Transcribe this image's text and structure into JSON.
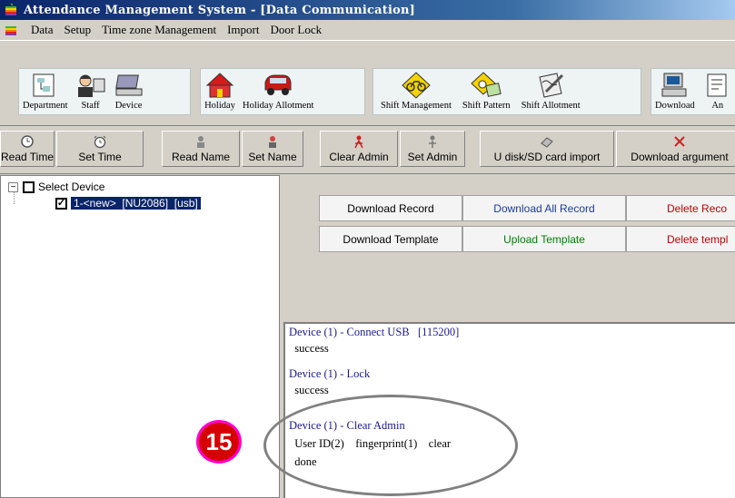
{
  "window": {
    "title": "Attendance Management System - [Data Communication]"
  },
  "menubar": {
    "items": [
      "Data",
      "Setup",
      "Time zone Management",
      "Import",
      "Door Lock"
    ]
  },
  "toolbar": {
    "items": [
      {
        "label": "Department",
        "icon": "department-icon"
      },
      {
        "label": "Staff",
        "icon": "staff-icon"
      },
      {
        "label": "Device",
        "icon": "device-icon"
      },
      {
        "label": "Holiday",
        "icon": "holiday-icon"
      },
      {
        "label": "Holiday Allotment",
        "icon": "car-icon"
      },
      {
        "label": "Shift Management",
        "icon": "bicycle-sign-icon"
      },
      {
        "label": "Shift Pattern",
        "icon": "clock-sign-icon"
      },
      {
        "label": "Shift Allotment",
        "icon": "pen-document-icon"
      },
      {
        "label": "Download",
        "icon": "computer-icon"
      },
      {
        "label": "An",
        "icon": "report-icon"
      }
    ]
  },
  "device_toolbar": {
    "items": [
      {
        "label": "Read Time",
        "icon": "clock-icon"
      },
      {
        "label": "Set Time",
        "icon": "alarm-clock-icon"
      },
      {
        "label": "Read Name",
        "icon": "read-name-icon"
      },
      {
        "label": "Set Name",
        "icon": "set-name-icon"
      },
      {
        "label": "Clear Admin",
        "icon": "clear-admin-icon"
      },
      {
        "label": "Set Admin",
        "icon": "set-admin-icon"
      },
      {
        "label": "U disk/SD card import",
        "icon": "sd-card-icon"
      },
      {
        "label": "Download argument",
        "icon": "download-argument-icon"
      }
    ]
  },
  "device_tree": {
    "root_label": "Select Device",
    "device_label": "1-<new>  [NU2086]  [usb]",
    "device_checked": true
  },
  "actions": {
    "download_record": "Download Record",
    "download_all_record": "Download All Record",
    "delete_record": "Delete Reco",
    "download_template": "Download Template",
    "upload_template": "Upload Template",
    "delete_template": "Delete templ"
  },
  "log": {
    "lines": [
      {
        "text": "Device (1) - Connect USB   [115200]",
        "kind": "head"
      },
      {
        "text": "  success",
        "kind": "body"
      },
      {
        "text": "Device (1) - Lock",
        "kind": "head"
      },
      {
        "text": "  success",
        "kind": "body"
      },
      {
        "text": "Device (1) - Clear Admin",
        "kind": "head"
      },
      {
        "text": "  User ID(2)    fingerprint(1)    clear",
        "kind": "body"
      },
      {
        "text": "  done",
        "kind": "body"
      }
    ]
  },
  "annotation": {
    "step_number": "15"
  },
  "colors": {
    "title_gradient_start": "#0a246a",
    "selection": "#0a246a",
    "log_heading": "#1a1a8c",
    "badge_fill": "#d60000",
    "badge_ring": "#ff00cc",
    "upload_template_text": "#008000",
    "delete_text": "#c00000",
    "download_all_text": "#1a3c9c"
  }
}
